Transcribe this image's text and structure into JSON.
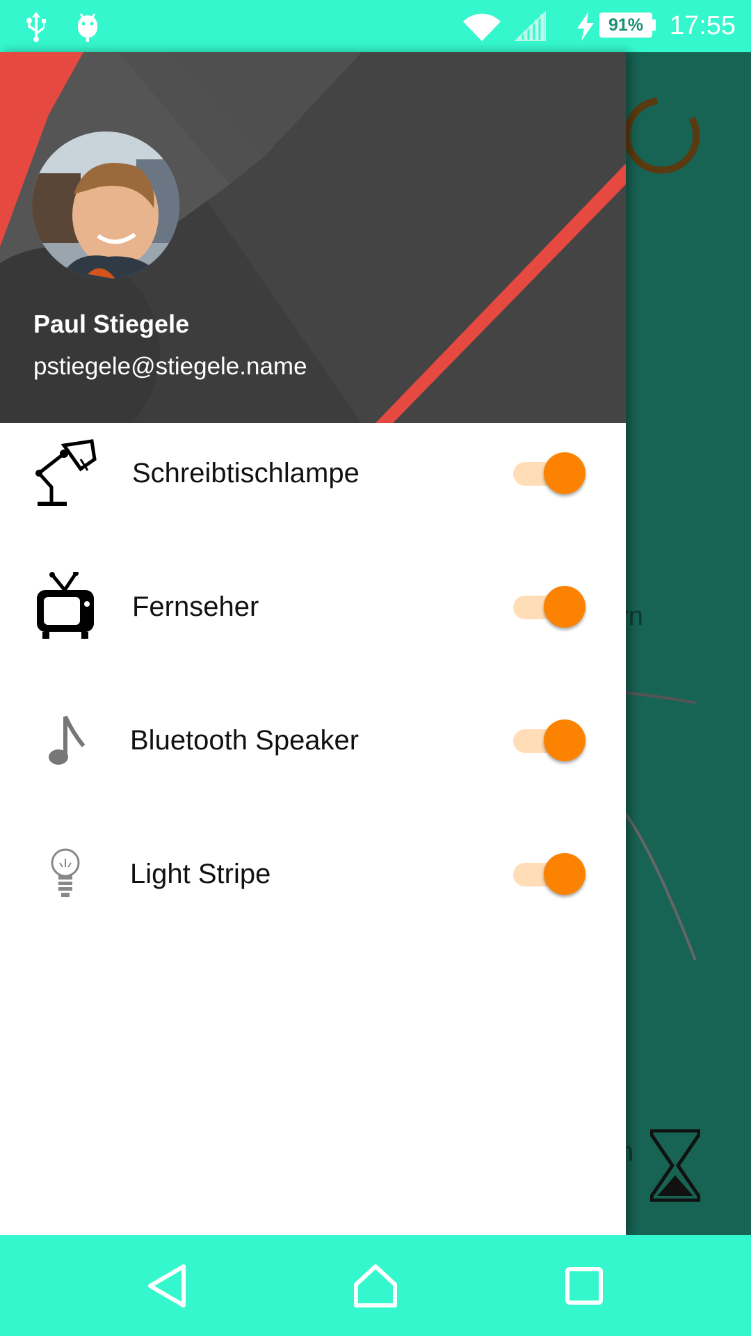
{
  "status_bar": {
    "time": "17:55",
    "battery": "91%",
    "icons": [
      "usb-icon",
      "android-debug-icon",
      "wifi-icon",
      "signal-icon",
      "charging-icon",
      "battery-icon"
    ]
  },
  "background_app": {
    "partial_text_1": "ern",
    "partial_text_2": "n",
    "colors": {
      "background": "#176354",
      "spinner": "#5a3a10"
    }
  },
  "drawer": {
    "user": {
      "name": "Paul Stiegele",
      "email": "pstiegele@stiegele.name"
    },
    "devices": [
      {
        "label": "Schreibtischlampe",
        "icon": "desk-lamp-icon",
        "enabled": true
      },
      {
        "label": "Fernseher",
        "icon": "tv-icon",
        "enabled": true
      },
      {
        "label": "Bluetooth Speaker",
        "icon": "music-note-icon",
        "enabled": true
      },
      {
        "label": "Light Stripe",
        "icon": "light-bulb-icon",
        "enabled": true
      }
    ]
  },
  "nav_bar": {
    "buttons": [
      "back-icon",
      "home-icon",
      "recents-icon"
    ]
  },
  "colors": {
    "accent": "#35F7CD",
    "toggle_thumb": "#FB8301",
    "toggle_track": "#FFDDB7",
    "header_stripe": "#E74C3C"
  }
}
